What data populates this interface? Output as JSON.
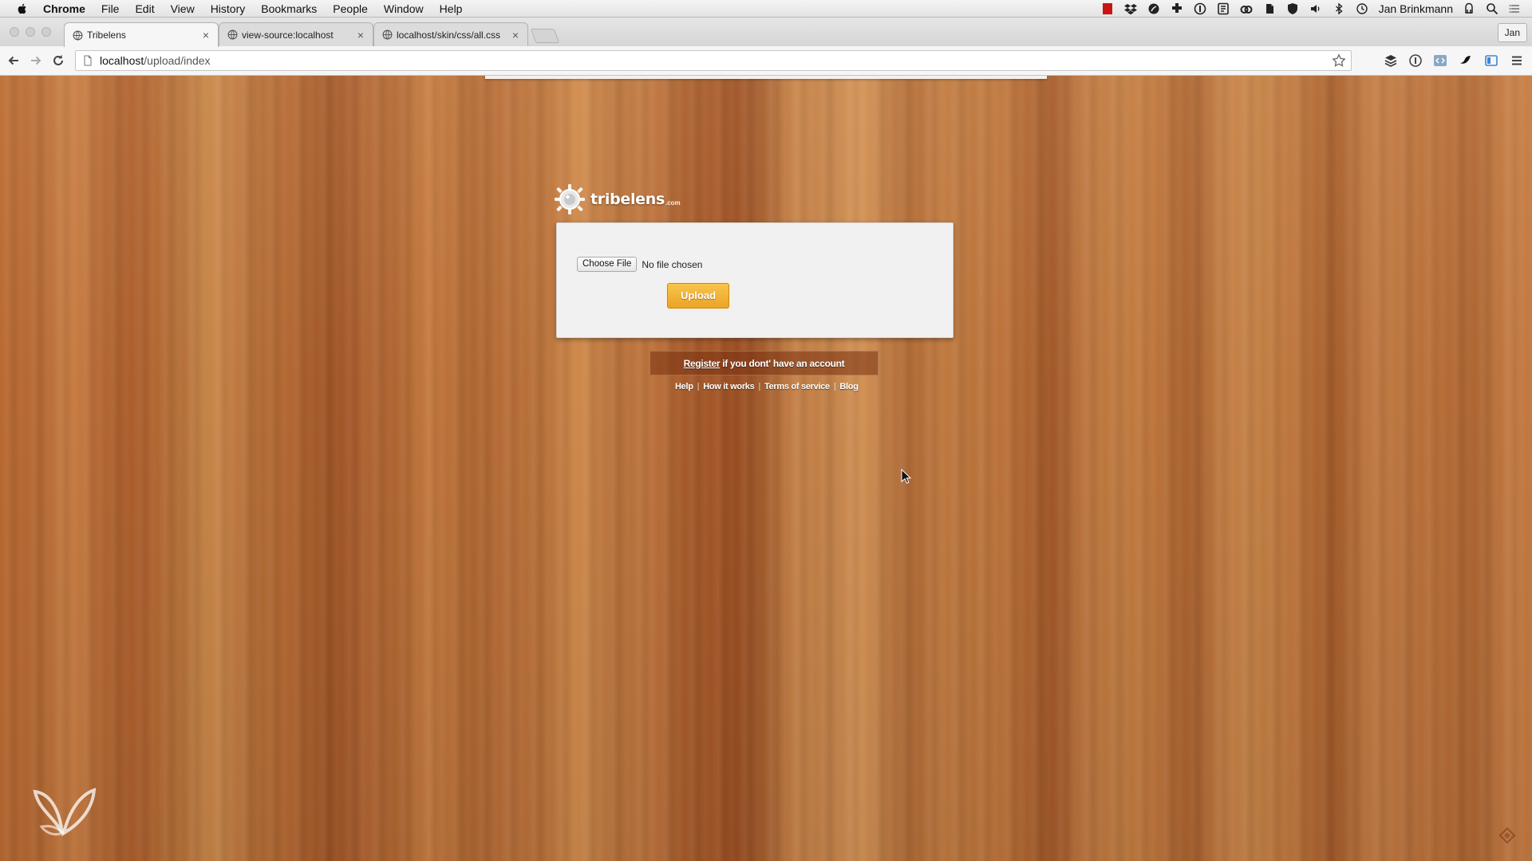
{
  "menubar": {
    "app_name": "Chrome",
    "items": [
      "File",
      "Edit",
      "View",
      "History",
      "Bookmarks",
      "People",
      "Window",
      "Help"
    ],
    "user": "Jan Brinkmann"
  },
  "tabs": [
    {
      "title": "Tribelens",
      "close": "×",
      "active": true
    },
    {
      "title": "view-source:localhost",
      "close": "×",
      "active": false
    },
    {
      "title": "localhost/skin/css/all.css",
      "close": "×",
      "active": false
    }
  ],
  "profile_label": "Jan",
  "address": {
    "host": "localhost",
    "path": "/upload/index"
  },
  "page": {
    "brand": "tribelens",
    "brand_suffix": ".com",
    "choose_file_label": "Choose File",
    "file_status": "No file chosen",
    "upload_label": "Upload",
    "register_link": "Register",
    "register_text": "if you dont' have an account",
    "footer_links": [
      "Help",
      "How it works",
      "Terms of service",
      "Blog"
    ],
    "footer_separator": "|"
  }
}
